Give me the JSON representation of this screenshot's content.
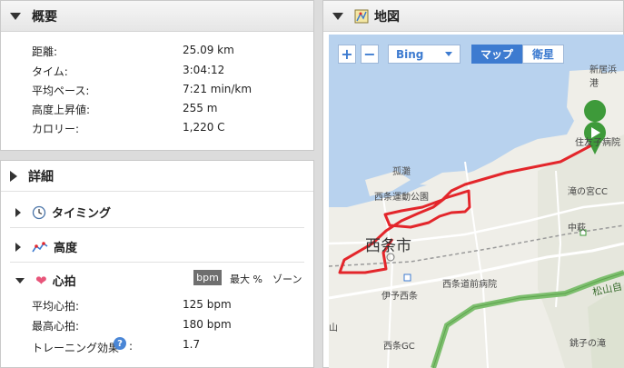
{
  "summary": {
    "title": "概要",
    "rows": [
      {
        "label": "距離:",
        "value": "25.09 km"
      },
      {
        "label": "タイム:",
        "value": "3:04:12"
      },
      {
        "label": "平均ペース:",
        "value": "7:21 min/km"
      },
      {
        "label": "高度上昇値:",
        "value": "255 m"
      },
      {
        "label": "カロリー:",
        "value": "1,220 C"
      }
    ]
  },
  "details": {
    "title": "詳細",
    "timing": "タイミング",
    "altitude": "高度",
    "heart": {
      "label": "心拍",
      "tabs": [
        "bpm",
        "最大 %",
        "ゾーン"
      ],
      "rows": [
        {
          "label": "平均心拍:",
          "value": "125 bpm"
        },
        {
          "label": "最高心拍:",
          "value": "180 bpm"
        },
        {
          "label": "トレーニング効果",
          "value": "1.7"
        }
      ]
    }
  },
  "map": {
    "title": "地図",
    "zoom_in": "+",
    "zoom_out": "−",
    "provider": "Bing",
    "view_map": "マップ",
    "view_sat": "衛星",
    "labels": {
      "city": "西条市",
      "park": "西条運動公園",
      "komatsu": "孤灘",
      "hospital": "西条道前病院",
      "station": "伊予西条",
      "takino": "滝の宮CC",
      "nakahagi": "中萩",
      "matsuyama": "松山自",
      "saijogc": "西条GC",
      "niihama": "新居浜港",
      "sumitomo": "住友子病院",
      "chosi": "銚子の滝",
      "yama": "山"
    }
  },
  "colors": {
    "route": "#e3262b",
    "sea": "#b8d2ee",
    "land": "#efeee8",
    "highway": "#7dbf6e",
    "accent": "#3d7bd0"
  }
}
